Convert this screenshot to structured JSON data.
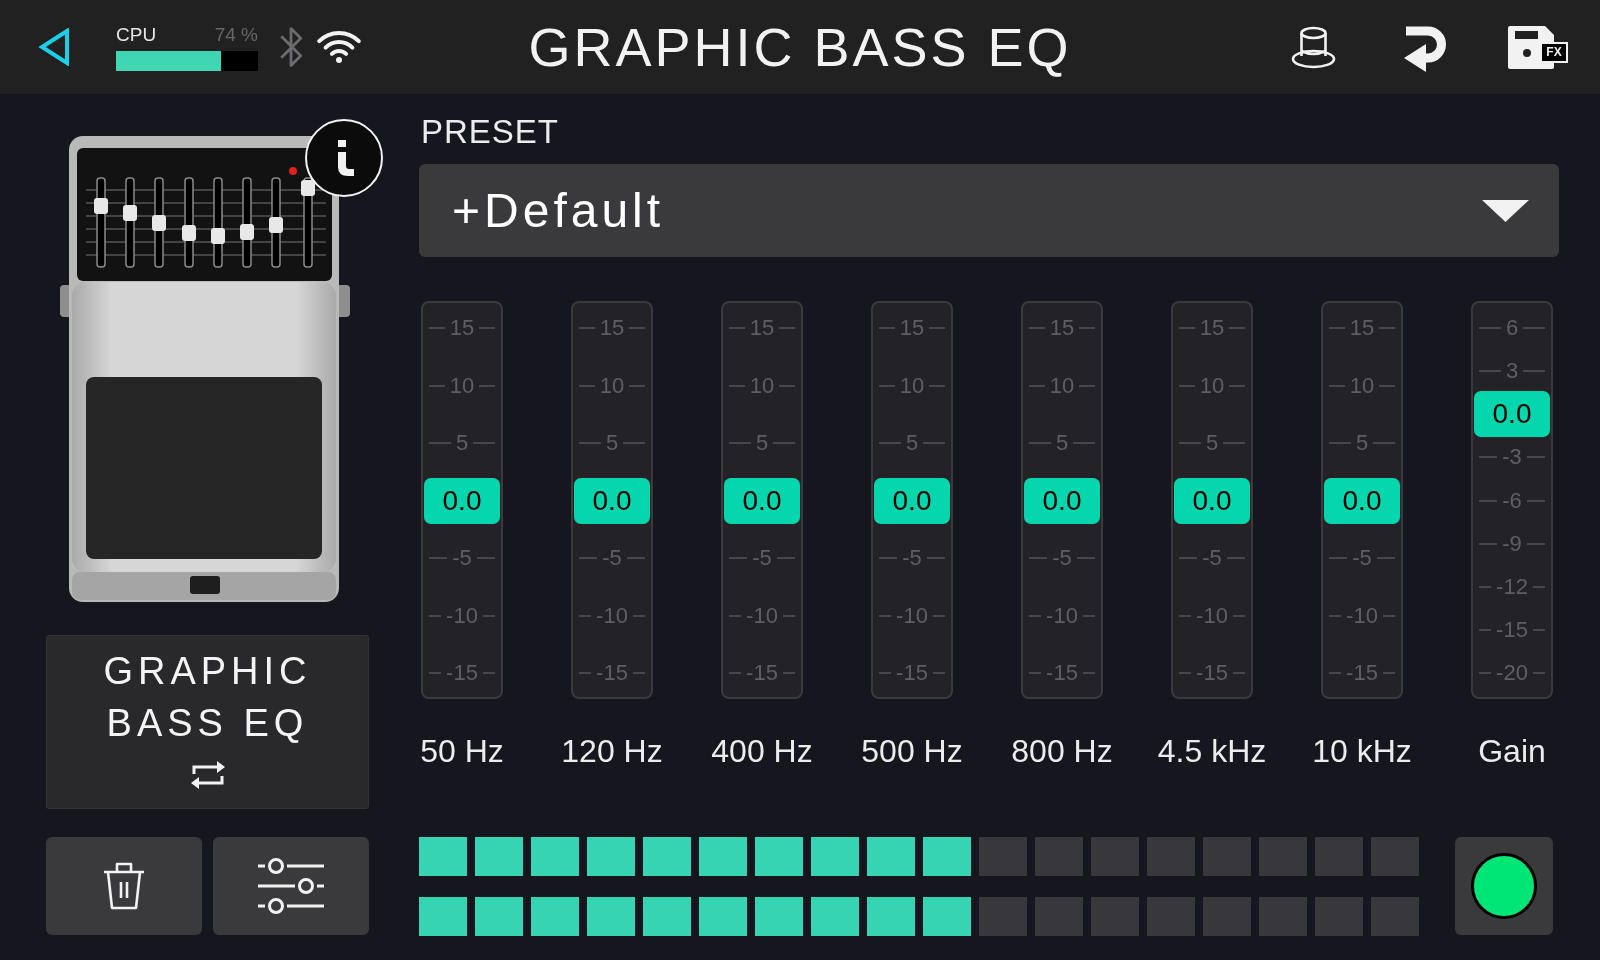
{
  "top_bar": {
    "cpu": {
      "label": "CPU",
      "reading": "74 %",
      "level": 0.74
    },
    "bluetooth": {
      "on": false
    },
    "wifi": {
      "on": true
    },
    "title": "GRAPHIC BASS EQ",
    "save_badge": "FX"
  },
  "model": {
    "name": "GRAPHIC BASS EQ"
  },
  "preset": {
    "label": "PRESET",
    "value": "+Default"
  },
  "sliders": [
    {
      "label": "50 Hz",
      "value": "0.0",
      "level": 0.5,
      "ticks": [
        "15",
        "10",
        "5",
        "-5",
        "-10",
        "-15"
      ]
    },
    {
      "label": "120 Hz",
      "value": "0.0",
      "level": 0.5,
      "ticks": [
        "15",
        "10",
        "5",
        "-5",
        "-10",
        "-15"
      ]
    },
    {
      "label": "400 Hz",
      "value": "0.0",
      "level": 0.5,
      "ticks": [
        "15",
        "10",
        "5",
        "-5",
        "-10",
        "-15"
      ]
    },
    {
      "label": "500 Hz",
      "value": "0.0",
      "level": 0.5,
      "ticks": [
        "15",
        "10",
        "5",
        "-5",
        "-10",
        "-15"
      ]
    },
    {
      "label": "800 Hz",
      "value": "0.0",
      "level": 0.5,
      "ticks": [
        "15",
        "10",
        "5",
        "-5",
        "-10",
        "-15"
      ]
    },
    {
      "label": "4.5 kHz",
      "value": "0.0",
      "level": 0.5,
      "ticks": [
        "15",
        "10",
        "5",
        "-5",
        "-10",
        "-15"
      ]
    },
    {
      "label": "10 kHz",
      "value": "0.0",
      "level": 0.5,
      "ticks": [
        "15",
        "10",
        "5",
        "-5",
        "-10",
        "-15"
      ]
    },
    {
      "label": "Gain",
      "value": "0.0",
      "level": 0.75,
      "ticks": [
        "6",
        "3",
        "-3",
        "-6",
        "-9",
        "-12",
        "-15",
        "-20"
      ]
    }
  ],
  "meters": [
    {
      "level": 0.56
    },
    {
      "level": 0.56
    }
  ],
  "footswitch": {
    "on": true
  }
}
